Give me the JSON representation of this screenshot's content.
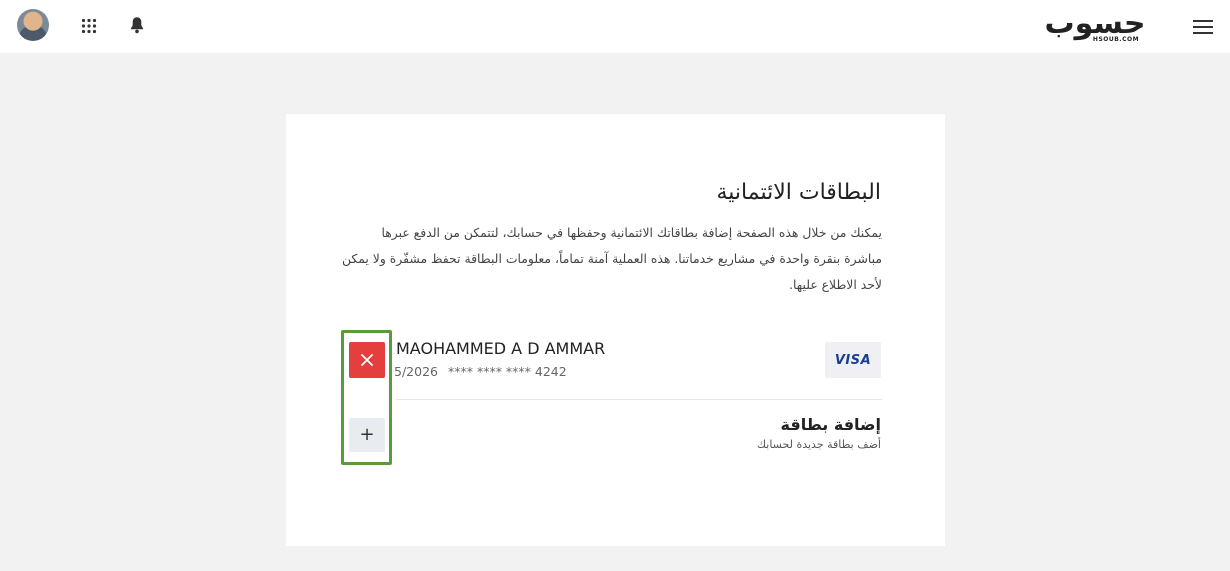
{
  "topbar": {
    "logo_text": "حسوب",
    "logo_domain": "HSOUB.COM",
    "icons": {
      "avatar": "user-avatar",
      "apps": "apps-grid-icon",
      "notifications": "bell-icon",
      "menu": "hamburger-menu-icon"
    }
  },
  "page": {
    "title": "البطاقات الائتمانية",
    "description": "يمكنك من خلال هذه الصفحة إضافة بطاقاتك الائتمانية وحفظها في حسابك، لتتمكن من الدفع عبرها مباشرة بنقرة واحدة في مشاريع خدماتنا. هذه العملية آمنة تماماً، معلومات البطاقة تحفظ مشفّرة ولا يمكن لأحد الاطلاع عليها."
  },
  "saved_card": {
    "holder_name": "MAOHAMMED A D AMMAR",
    "expiry": "5/2026",
    "masked_number": "**** **** **** 4242",
    "brand": "VISA",
    "delete_icon": "close-icon"
  },
  "add_card": {
    "title": "إضافة بطاقة",
    "subtitle": "أضف بطاقة جديدة لحسابك",
    "button_symbol": "+"
  },
  "colors": {
    "background": "#f2f2f2",
    "delete_button": "#e53e3e",
    "highlight_border": "#5a9a3a",
    "visa_text": "#1a3d8f"
  }
}
